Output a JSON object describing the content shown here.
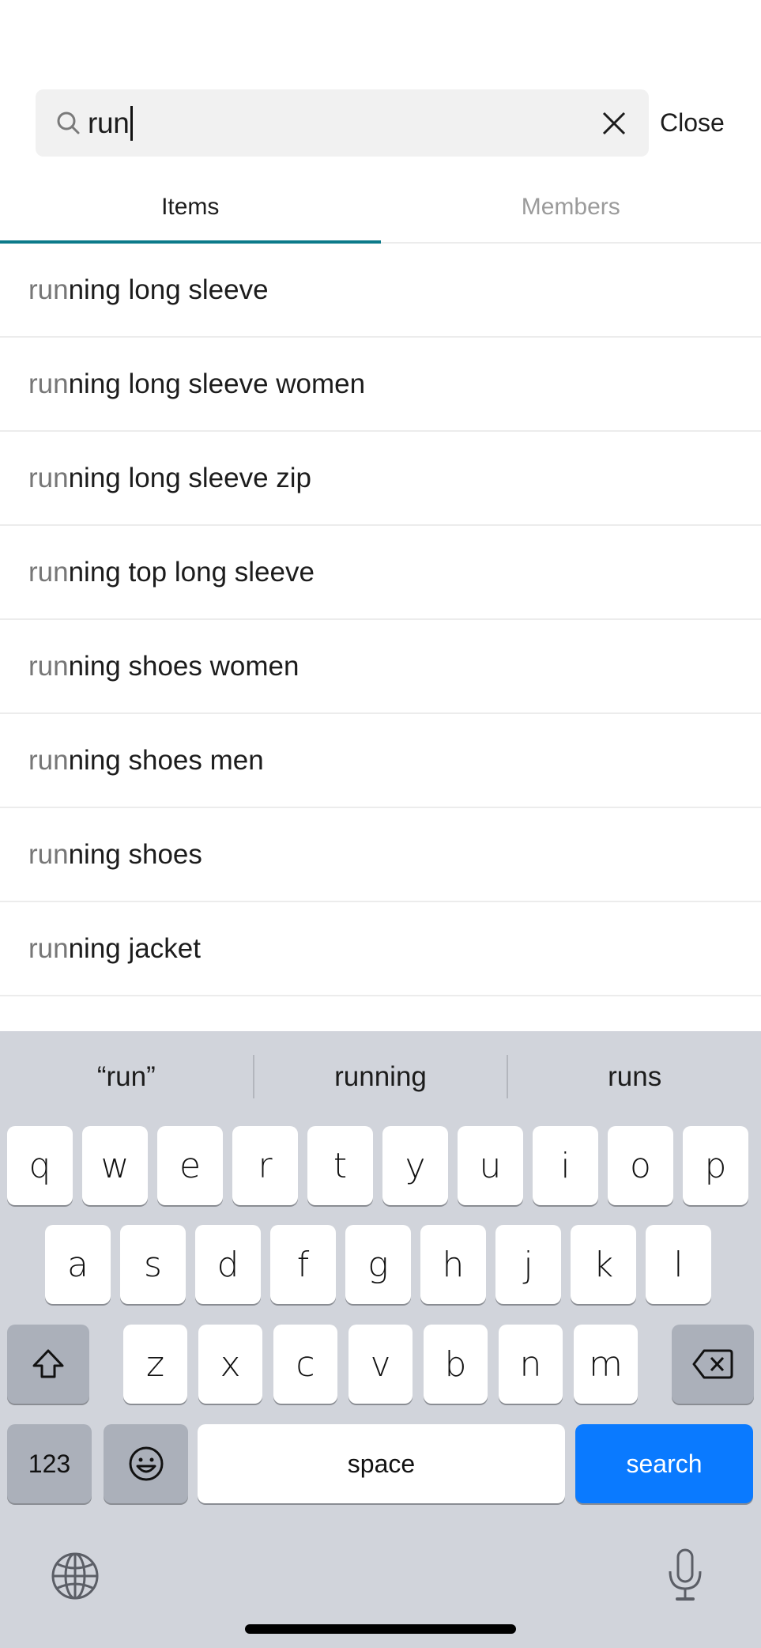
{
  "search": {
    "query": "run",
    "close_label": "Close",
    "icons": {
      "search": "search-icon",
      "clear": "close-icon"
    }
  },
  "tabs": [
    {
      "label": "Items",
      "active": true
    },
    {
      "label": "Members",
      "active": false
    }
  ],
  "suggestions": [
    {
      "prefix": "run",
      "rest": "ning long sleeve"
    },
    {
      "prefix": "run",
      "rest": "ning long sleeve women"
    },
    {
      "prefix": "run",
      "rest": "ning long sleeve zip"
    },
    {
      "prefix": "run",
      "rest": "ning top long sleeve"
    },
    {
      "prefix": "run",
      "rest": "ning shoes women"
    },
    {
      "prefix": "run",
      "rest": "ning shoes men"
    },
    {
      "prefix": "run",
      "rest": "ning shoes"
    },
    {
      "prefix": "run",
      "rest": "ning jacket"
    }
  ],
  "keyboard": {
    "predictions": [
      "“run”",
      "running",
      "runs"
    ],
    "row1": [
      "q",
      "w",
      "e",
      "r",
      "t",
      "y",
      "u",
      "i",
      "o",
      "p"
    ],
    "row2": [
      "a",
      "s",
      "d",
      "f",
      "g",
      "h",
      "j",
      "k",
      "l"
    ],
    "row3": [
      "z",
      "x",
      "c",
      "v",
      "b",
      "n",
      "m"
    ],
    "numbers_label": "123",
    "space_label": "space",
    "search_label": "search",
    "icons": {
      "shift": "shift-icon",
      "backspace": "backspace-icon",
      "emoji": "emoji-icon",
      "globe": "globe-icon",
      "mic": "microphone-icon"
    },
    "accent_color": "#0a7aff"
  },
  "colors": {
    "tab_indicator": "#0c7a8a",
    "keyboard_bg": "#d1d4db"
  }
}
